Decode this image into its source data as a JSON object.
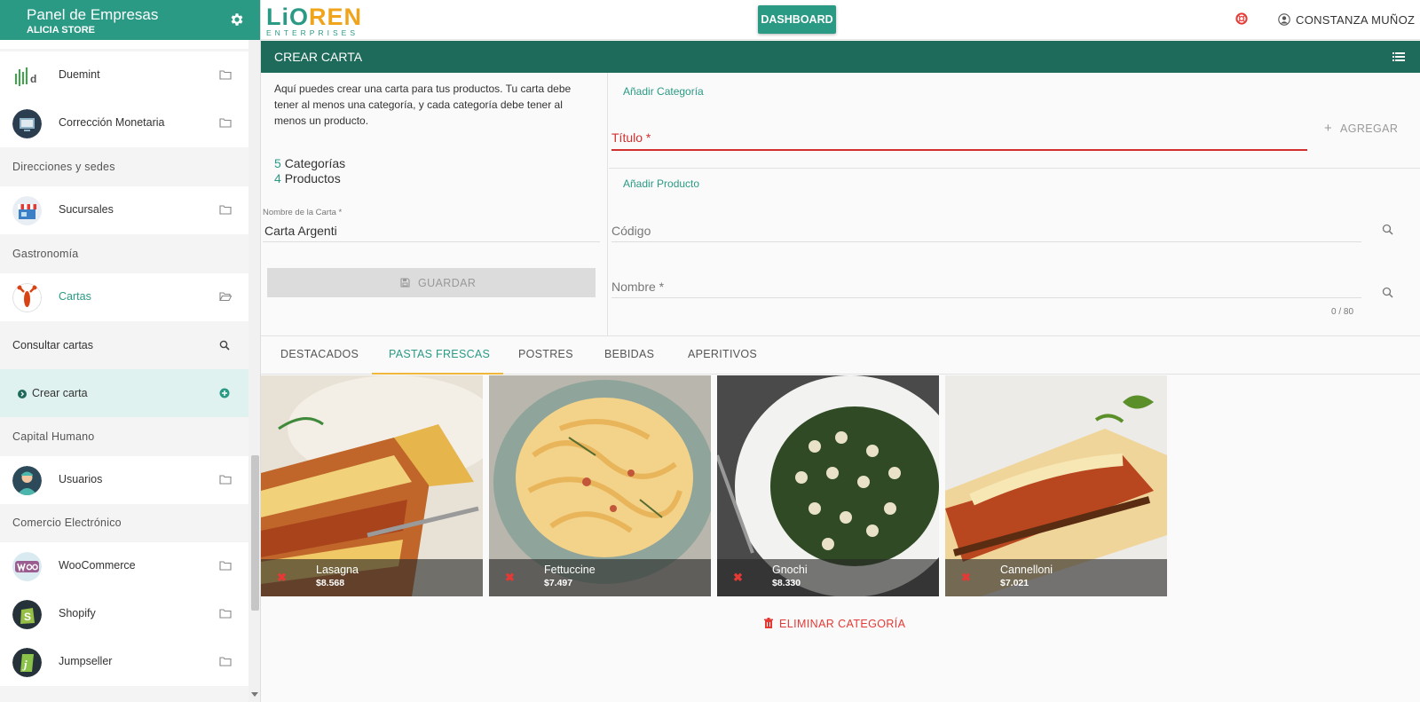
{
  "sidebar": {
    "title": "Panel de Empresas",
    "store": "ALICIA STORE",
    "items": [
      {
        "label": "Duemint"
      },
      {
        "label": "Corrección Monetaria"
      },
      {
        "label": "Sucursales"
      },
      {
        "label": "Cartas"
      },
      {
        "label": "Usuarios"
      },
      {
        "label": "WooCommerce"
      },
      {
        "label": "Shopify"
      },
      {
        "label": "Jumpseller"
      }
    ],
    "sections": [
      "Direcciones y sedes",
      "Gastronomía",
      "Capital Humano",
      "Comercio Electrónico"
    ],
    "sub_items": [
      {
        "label": "Consultar cartas"
      },
      {
        "label": "Crear carta"
      }
    ]
  },
  "topbar": {
    "logo_main_a": "LiO",
    "logo_main_b": "REN",
    "logo_sub": "ENTERPRISES",
    "dashboard_label": "DASHBOARD",
    "user_name": "CONSTANZA MUÑOZ"
  },
  "panel": {
    "title": "CREAR CARTA"
  },
  "left": {
    "intro": "Aquí puedes crear una carta para tus productos. Tu carta debe tener al menos una categoría, y cada categoría debe tener al menos un producto.",
    "categories_count": "5",
    "categories_label": "Categorías",
    "products_count": "4",
    "products_label": "Productos",
    "carta_name_label": "Nombre de la Carta *",
    "carta_name_value": "Carta Argenti",
    "save_label": "GUARDAR"
  },
  "right": {
    "add_category_title": "Añadir Categoría",
    "titulo_label": "Título *",
    "add_label": "AGREGAR",
    "add_product_title": "Añadir Producto",
    "codigo_label": "Código",
    "nombre_label": "Nombre *",
    "counter": "0 / 80"
  },
  "tabs": [
    {
      "label": "DESTACADOS"
    },
    {
      "label": "PASTAS FRESCAS"
    },
    {
      "label": "POSTRES"
    },
    {
      "label": "BEBIDAS"
    },
    {
      "label": "APERITIVOS"
    }
  ],
  "active_tab": "PASTAS FRESCAS",
  "products": [
    {
      "name": "Lasagna",
      "price": "$8.568"
    },
    {
      "name": "Fettuccine",
      "price": "$7.497"
    },
    {
      "name": "Gnochi",
      "price": "$8.330"
    },
    {
      "name": "Cannelloni",
      "price": "$7.021"
    }
  ],
  "delete_category_label": "ELIMINAR CATEGORÍA",
  "colors": {
    "primary": "#2a9a85",
    "header_dark": "#1e6b5c",
    "accent": "#f0a41c",
    "danger": "#e53935"
  }
}
